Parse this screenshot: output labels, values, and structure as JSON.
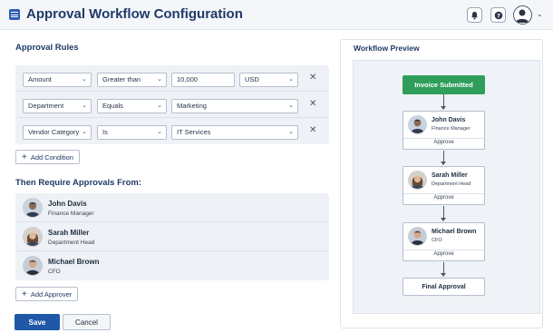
{
  "header": {
    "title": "Approval Workflow Configuration",
    "menu_icon": "hamburger-menu-icon",
    "notifications_icon": "bell-icon",
    "help_icon": "help-icon",
    "profile_icon": "user-avatar-icon",
    "profile_chevron": "⌄"
  },
  "rules": {
    "title": "Approval Rules",
    "rows": [
      {
        "field": "Amount",
        "operator": "Greater than",
        "value": "10,000",
        "unit": "USD"
      },
      {
        "field": "Department",
        "operator": "Equals",
        "value": "Marketing"
      },
      {
        "field": "Vendor Category",
        "operator": "Is",
        "value": "IT Services"
      }
    ],
    "add_condition_label": "Add Condition",
    "remove_glyph": "✕",
    "chevron_glyph": "⌄",
    "plus_glyph": "+"
  },
  "approvers": {
    "title": "Then Require Approvals From:",
    "list": [
      {
        "name": "John Davis",
        "role": "Finance Manager"
      },
      {
        "name": "Sarah Miller",
        "role": "Department Head"
      },
      {
        "name": "Michael Brown",
        "role": "CFO"
      }
    ],
    "add_approver_label": "Add Approver"
  },
  "actions": {
    "save_label": "Save",
    "cancel_label": "Cancel"
  },
  "preview": {
    "title": "Workflow Preview",
    "start_label": "Invoice Submitted",
    "steps": [
      {
        "name": "John Davis",
        "role": "Finance Manager",
        "action": "Approve"
      },
      {
        "name": "Sarah Miller",
        "role": "Department Head",
        "action": "Approve"
      },
      {
        "name": "Michael Brown",
        "role": "CFO",
        "action": "Approve"
      }
    ],
    "end_label": "Final Approval"
  },
  "colors": {
    "accent": "#2058a8",
    "start_node": "#2e9e5a",
    "title": "#1f3a66"
  }
}
